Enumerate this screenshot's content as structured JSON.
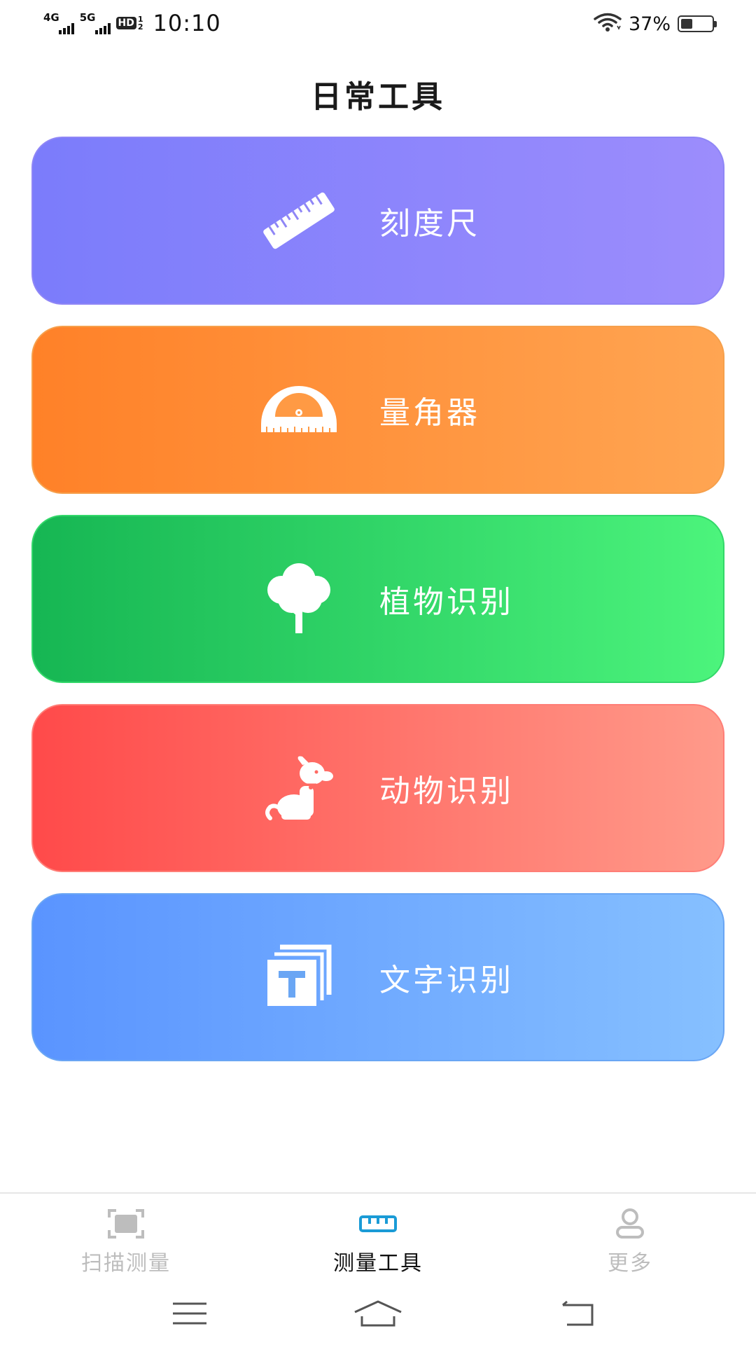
{
  "status_bar": {
    "network_1": "4G",
    "network_2": "5G",
    "hd_label": "HD",
    "hd_sub_top": "1",
    "hd_sub_bottom": "2",
    "time": "10:10",
    "battery_percent": "37%",
    "battery_level": 0.37,
    "icons": [
      "signal-icon",
      "wifi-icon",
      "battery-icon"
    ]
  },
  "page": {
    "title": "日常工具"
  },
  "tools": [
    {
      "label": "刻度尺",
      "icon": "ruler-icon",
      "colors": [
        "#7b7cfb",
        "#9c8dfc"
      ]
    },
    {
      "label": "量角器",
      "icon": "protractor-icon",
      "colors": [
        "#ff8128",
        "#ffa552"
      ]
    },
    {
      "label": "植物识别",
      "icon": "tree-icon",
      "colors": [
        "#16b653",
        "#4cf47c"
      ]
    },
    {
      "label": "动物识别",
      "icon": "dog-icon",
      "colors": [
        "#ff4a4a",
        "#ff9a8a"
      ]
    },
    {
      "label": "文字识别",
      "icon": "text-recognition-icon",
      "colors": [
        "#5a94ff",
        "#86c0ff"
      ]
    }
  ],
  "bottom_nav": {
    "items": [
      {
        "label": "扫描测量",
        "icon": "scan-icon",
        "active": false
      },
      {
        "label": "测量工具",
        "icon": "ruler-tab-icon",
        "active": true
      },
      {
        "label": "更多",
        "icon": "user-icon",
        "active": false
      }
    ],
    "active_color": "#1a9bd6",
    "inactive_color": "#bdbdbd"
  },
  "system_nav": {
    "icons": [
      "menu-icon",
      "home-icon",
      "back-icon"
    ]
  }
}
